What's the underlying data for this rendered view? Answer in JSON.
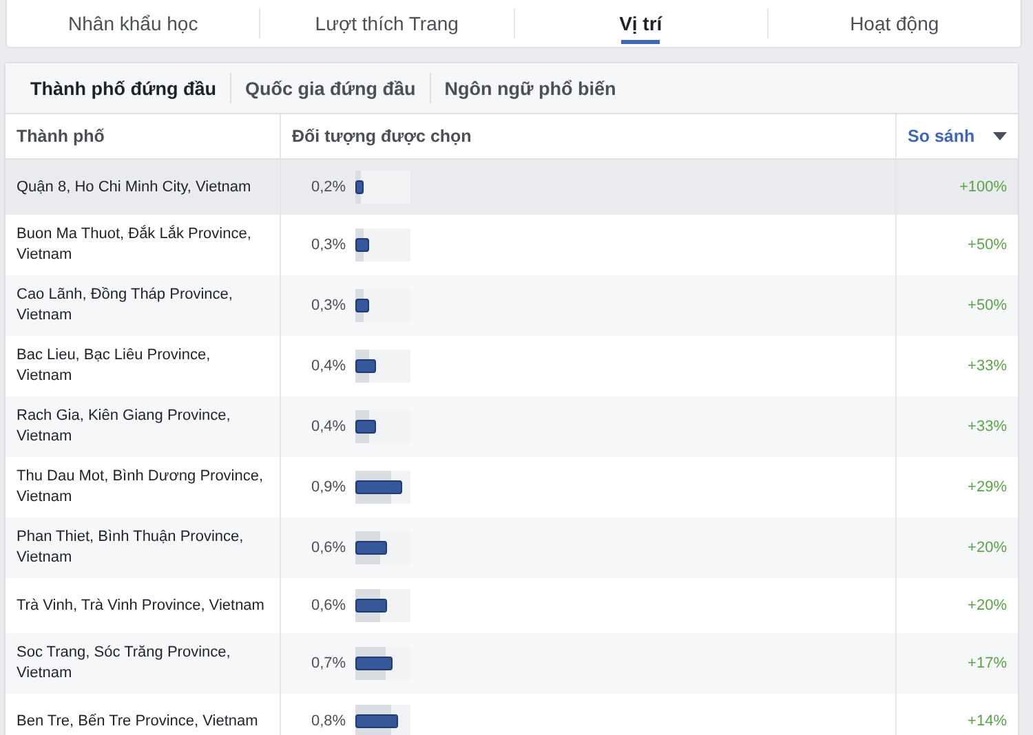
{
  "tabs": [
    {
      "label": "Nhân khẩu học",
      "selected": false
    },
    {
      "label": "Lượt thích Trang",
      "selected": false
    },
    {
      "label": "Vị trí",
      "selected": true
    },
    {
      "label": "Hoạt động",
      "selected": false
    }
  ],
  "subtabs": [
    {
      "label": "Thành phố đứng đầu",
      "selected": true
    },
    {
      "label": "Quốc gia đứng đầu",
      "selected": false
    },
    {
      "label": "Ngôn ngữ phổ biến",
      "selected": false
    }
  ],
  "table": {
    "columns": [
      "Thành phố",
      "Đối tượng được chọn",
      "So sánh"
    ],
    "rows": [
      {
        "city": "Quận 8, Ho Chi Minh City, Vietnam",
        "share": "0,2%",
        "audience_bar": {
          "level": 0.15
        },
        "baseline_bar": {
          "level": 0.1
        },
        "comparison": "+100%",
        "selected": true
      },
      {
        "city": "Buon Ma Thuot, Đắk Lắk Province, Vietnam",
        "share": "0,3%",
        "audience_bar": {
          "level": 0.25
        },
        "baseline_bar": {
          "level": 0.15
        },
        "comparison": "+50%",
        "selected": false
      },
      {
        "city": "Cao Lãnh, Đồng Tháp Province, Vietnam",
        "share": "0,3%",
        "audience_bar": {
          "level": 0.25
        },
        "baseline_bar": {
          "level": 0.15
        },
        "comparison": "+50%",
        "selected": false
      },
      {
        "city": "Bac Lieu, Bạc Liêu Province, Vietnam",
        "share": "0,4%",
        "audience_bar": {
          "level": 0.38
        },
        "baseline_bar": {
          "level": 0.25
        },
        "comparison": "+33%",
        "selected": false
      },
      {
        "city": "Rach Gia, Kiên Giang Province, Vietnam",
        "share": "0,4%",
        "audience_bar": {
          "level": 0.38
        },
        "baseline_bar": {
          "level": 0.25
        },
        "comparison": "+33%",
        "selected": false
      },
      {
        "city": "Thu Dau Mot, Bình Dương Province, Vietnam",
        "share": "0,9%",
        "audience_bar": {
          "level": 0.85
        },
        "baseline_bar": {
          "level": 0.65
        },
        "comparison": "+29%",
        "selected": false
      },
      {
        "city": "Phan Thiet, Bình Thuận Province, Vietnam",
        "share": "0,6%",
        "audience_bar": {
          "level": 0.58
        },
        "baseline_bar": {
          "level": 0.45
        },
        "comparison": "+20%",
        "selected": false
      },
      {
        "city": "Trà Vinh, Trà Vinh Province, Vietnam",
        "share": "0,6%",
        "audience_bar": {
          "level": 0.58
        },
        "baseline_bar": {
          "level": 0.45
        },
        "comparison": "+20%",
        "selected": false
      },
      {
        "city": "Soc Trang, Sóc Trăng Province, Vietnam",
        "share": "0,7%",
        "audience_bar": {
          "level": 0.68
        },
        "baseline_bar": {
          "level": 0.55
        },
        "comparison": "+17%",
        "selected": false
      },
      {
        "city": "Ben Tre, Bến Tre Province, Vietnam",
        "share": "0,8%",
        "audience_bar": {
          "level": 0.78
        },
        "baseline_bar": {
          "level": 0.65
        },
        "comparison": "+14%",
        "selected": false
      }
    ]
  }
}
